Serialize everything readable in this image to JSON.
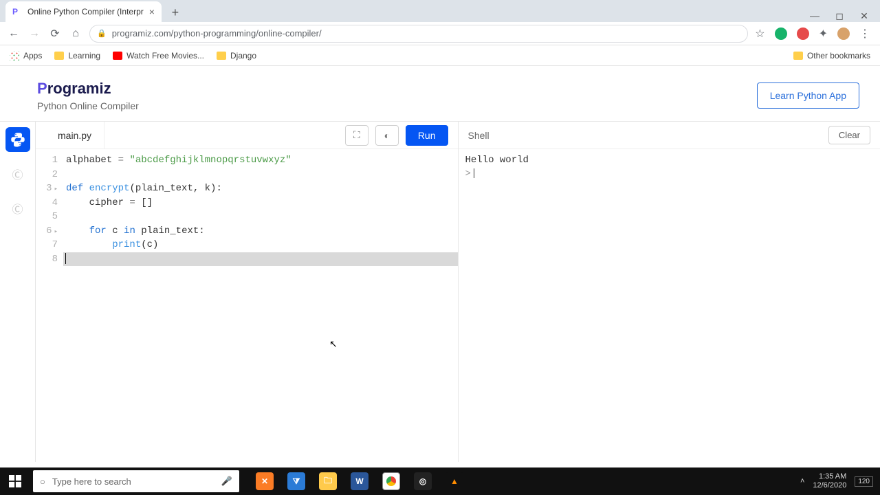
{
  "browser": {
    "tab_title": "Online Python Compiler (Interpr",
    "url": "programiz.com/python-programming/online-compiler/",
    "bookmarks": {
      "apps": "Apps",
      "learning": "Learning",
      "watch": "Watch Free Movies...",
      "django": "Django",
      "other": "Other bookmarks"
    }
  },
  "page": {
    "brand_p": "P",
    "brand_rest": "rogramiz",
    "subtitle": "Python Online Compiler",
    "learn_btn": "Learn Python App"
  },
  "editor": {
    "filename": "main.py",
    "run": "Run",
    "shell_label": "Shell",
    "clear": "Clear",
    "lines": [
      "1",
      "2",
      "3",
      "4",
      "5",
      "6",
      "7",
      "8"
    ],
    "fold_lines": [
      3,
      6
    ],
    "code": {
      "l1_id": "alphabet",
      "l1_op": " = ",
      "l1_str": "\"abcdefghijklmnopqrstuvwxyz\"",
      "l3_kw": "def",
      "l3_fn": " encrypt",
      "l3_rest": "(plain_text, k):",
      "l4_id": "    cipher",
      "l4_op": " = ",
      "l4_val": "[]",
      "l6_indent": "    ",
      "l6_kw": "for",
      "l6_mid": " c ",
      "l6_kw2": "in",
      "l6_rest": " plain_text:",
      "l7_indent": "        ",
      "l7_fn": "print",
      "l7_rest": "(c)"
    }
  },
  "shell": {
    "output": "Hello world",
    "prompt": ">"
  },
  "taskbar": {
    "search_placeholder": "Type here to search",
    "time": "1:35 AM",
    "date": "12/6/2020",
    "notify": "120"
  }
}
